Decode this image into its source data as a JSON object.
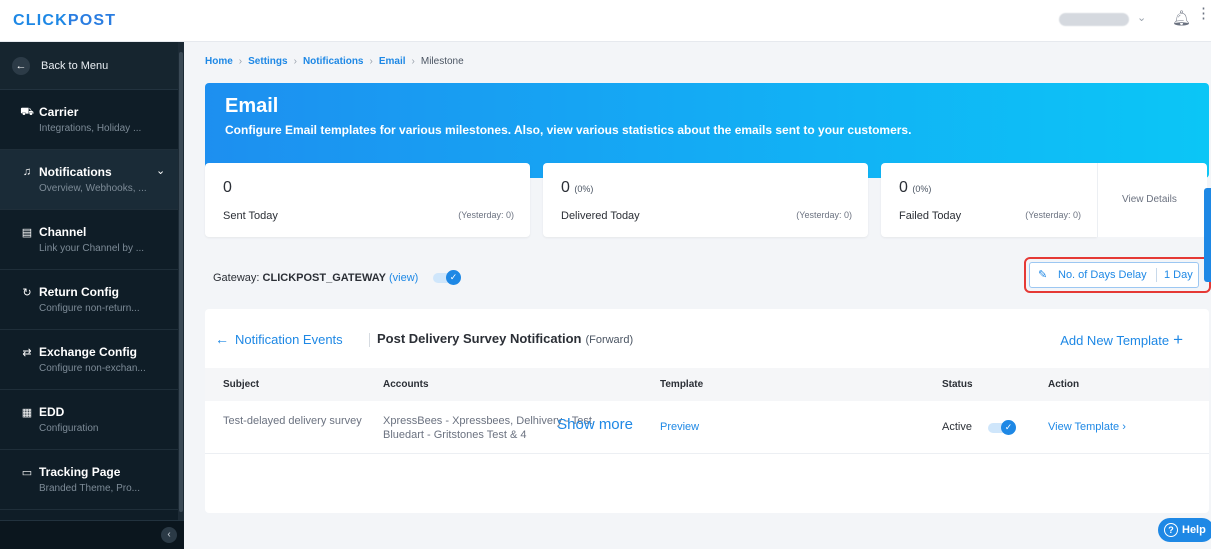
{
  "app": {
    "logo_part1": "CLICK",
    "logo_part2": "POST"
  },
  "sidebar": {
    "back_label": "Back to Menu",
    "items": [
      {
        "icon": "carrier-icon",
        "title": "Carrier",
        "subtitle": "Integrations, Holiday ..."
      },
      {
        "icon": "bell-icon",
        "title": "Notifications",
        "subtitle": "Overview, Webhooks, ...",
        "active": true
      },
      {
        "icon": "channel-icon",
        "title": "Channel",
        "subtitle": "Link your Channel by ..."
      },
      {
        "icon": "return-icon",
        "title": "Return Config",
        "subtitle": "Configure non-return..."
      },
      {
        "icon": "exchange-icon",
        "title": "Exchange Config",
        "subtitle": "Configure non-exchan..."
      },
      {
        "icon": "calendar-icon",
        "title": "EDD",
        "subtitle": "Configuration"
      },
      {
        "icon": "tracking-page-icon",
        "title": "Tracking Page",
        "subtitle": "Branded Theme, Pro..."
      }
    ]
  },
  "breadcrumb": {
    "items": [
      "Home",
      "Settings",
      "Notifications",
      "Email"
    ],
    "current": "Milestone"
  },
  "hero": {
    "title": "Email",
    "description": "Configure Email templates for various milestones. Also, view various statistics about the emails sent to your customers."
  },
  "stats": {
    "sent": {
      "value": "0",
      "pct": "",
      "label": "Sent Today",
      "yesterday": "(Yesterday: 0)"
    },
    "delivered": {
      "value": "0",
      "pct": "(0%)",
      "label": "Delivered Today",
      "yesterday": "(Yesterday: 0)"
    },
    "failed": {
      "value": "0",
      "pct": "(0%)",
      "label": "Failed Today",
      "yesterday": "(Yesterday: 0)"
    },
    "view_details": "View Details"
  },
  "gateway": {
    "label": "Gateway:",
    "name": "CLICKPOST_GATEWAY",
    "view_link": "(view)",
    "enabled": true
  },
  "delay": {
    "label": "No. of Days Delay",
    "value": "1 Day"
  },
  "panel": {
    "back_label": "Notification Events",
    "title": "Post Delivery Survey Notification",
    "direction": "(Forward)",
    "add_label": "Add New Template",
    "columns": [
      "Subject",
      "Accounts",
      "Template",
      "Status",
      "Action"
    ],
    "rows": [
      {
        "subject": "Test-delayed delivery survey",
        "accounts": "XpressBees - Xpressbees, Delhivery - Test, Bluedart - Gritstones Test & 4",
        "show_more": "Show more",
        "template": "Preview",
        "status": "Active",
        "action": "View Template"
      }
    ]
  },
  "help": {
    "label": "Help"
  },
  "colors": {
    "accent": "#1e88e5",
    "sidebar_bg": "#0f1d27",
    "highlight": "#e53935"
  }
}
